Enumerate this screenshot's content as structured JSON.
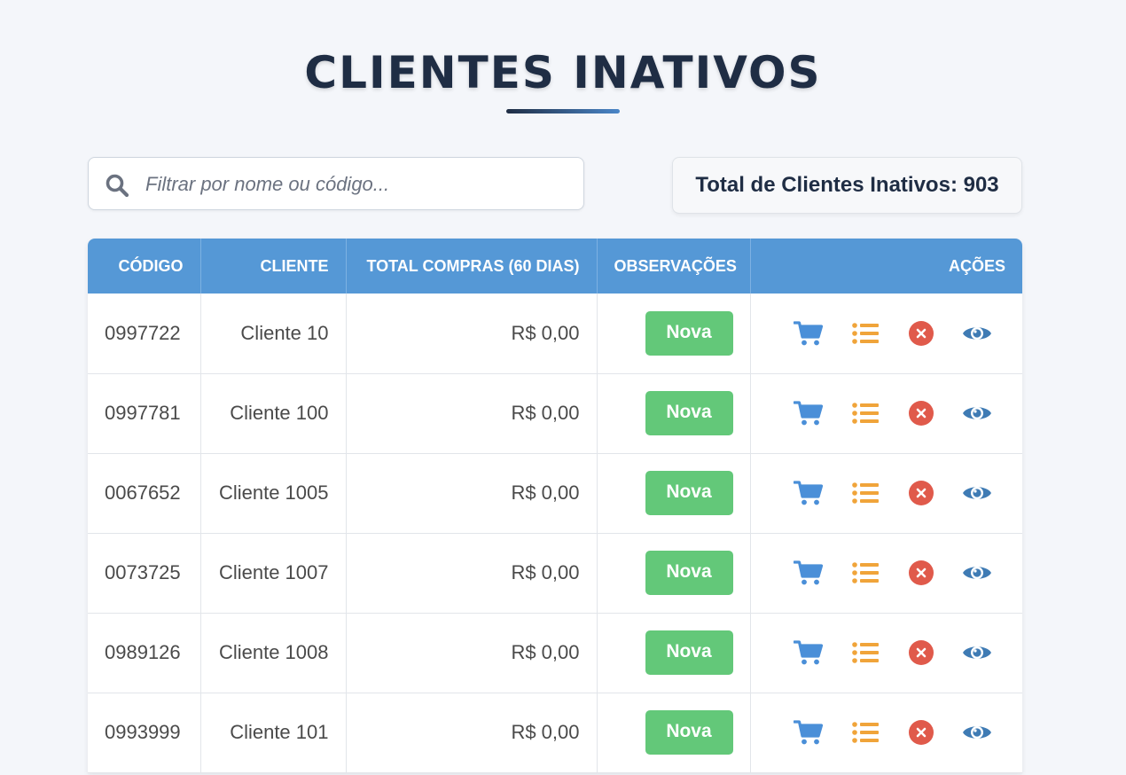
{
  "header": {
    "title": "CLIENTES INATIVOS"
  },
  "search": {
    "placeholder": "Filtrar por nome ou código...",
    "value": ""
  },
  "summary": {
    "total_label": "Total de Clientes Inativos: 903"
  },
  "table": {
    "columns": [
      "CÓDIGO",
      "CLIENTE",
      "TOTAL COMPRAS (60 DIAS)",
      "OBSERVAÇÕES",
      "AÇÕES"
    ],
    "rows": [
      {
        "code": "0997722",
        "client": "Cliente 10",
        "total": "R$ 0,00",
        "obs": "Nova"
      },
      {
        "code": "0997781",
        "client": "Cliente 100",
        "total": "R$ 0,00",
        "obs": "Nova"
      },
      {
        "code": "0067652",
        "client": "Cliente 1005",
        "total": "R$ 0,00",
        "obs": "Nova"
      },
      {
        "code": "0073725",
        "client": "Cliente 1007",
        "total": "R$ 0,00",
        "obs": "Nova"
      },
      {
        "code": "0989126",
        "client": "Cliente 1008",
        "total": "R$ 0,00",
        "obs": "Nova"
      },
      {
        "code": "0993999",
        "client": "Cliente 101",
        "total": "R$ 0,00",
        "obs": "Nova"
      }
    ],
    "action_icons": [
      "cart-icon",
      "list-icon",
      "close-circle-icon",
      "eye-icon"
    ]
  },
  "colors": {
    "header_bg": "#5598d6",
    "badge_bg": "#63c879",
    "cart": "#4a8fd8",
    "list": "#f0a43a",
    "close": "#e05a4b",
    "eye": "#3f7bb4"
  }
}
